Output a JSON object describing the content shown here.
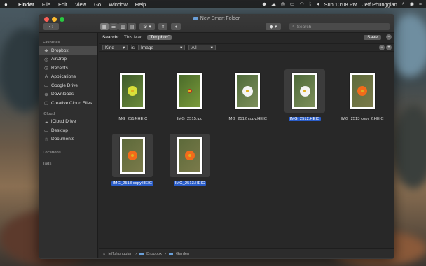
{
  "menubar": {
    "app": "Finder",
    "items": [
      "File",
      "Edit",
      "View",
      "Go",
      "Window",
      "Help"
    ],
    "clock": "Sun 10:08 PM",
    "user": "Jeff Phungglan"
  },
  "window": {
    "title": "New Smart Folder",
    "search_placeholder": "Search",
    "scope_label": "Search:",
    "scope_this_mac": "This Mac",
    "scope_active": "\"Dropbox\"",
    "save_label": "Save",
    "criteria": {
      "attribute": "Kind",
      "operator": "is",
      "value": "Image",
      "qualifier": "All"
    }
  },
  "sidebar": {
    "favorites_header": "Favorites",
    "favorites": [
      {
        "label": "Dropbox",
        "icon": "dropbox-icon"
      },
      {
        "label": "AirDrop",
        "icon": "airdrop-icon"
      },
      {
        "label": "Recents",
        "icon": "clock-icon"
      },
      {
        "label": "Applications",
        "icon": "applications-icon"
      },
      {
        "label": "Google Drive",
        "icon": "google-drive-icon"
      },
      {
        "label": "Downloads",
        "icon": "downloads-icon"
      },
      {
        "label": "Creative Cloud Files",
        "icon": "creative-cloud-icon"
      }
    ],
    "icloud_header": "iCloud",
    "icloud": [
      {
        "label": "iCloud Drive",
        "icon": "cloud-icon"
      },
      {
        "label": "Desktop",
        "icon": "desktop-icon"
      },
      {
        "label": "Documents",
        "icon": "document-icon"
      }
    ],
    "locations_header": "Locations",
    "tags_header": "Tags"
  },
  "files": [
    {
      "name": "IMG_2514.HEIC",
      "selected": false,
      "flower": "yellow"
    },
    {
      "name": "IMG_2515.jpg",
      "selected": false,
      "flower": "red-small"
    },
    {
      "name": "IMG_2512 copy.HEIC",
      "selected": false,
      "flower": "white"
    },
    {
      "name": "IMG_2512.HEIC",
      "selected": true,
      "flower": "white"
    },
    {
      "name": "IMG_2513 copy 2.HEIC",
      "selected": false,
      "flower": "orange"
    },
    {
      "name": "IMG_2513 copy.HEIC",
      "selected": true,
      "flower": "orange"
    },
    {
      "name": "IMG_2513.HEIC",
      "selected": true,
      "flower": "orange"
    }
  ],
  "pathbar": [
    "jeffphungglan",
    "Dropbox",
    "Garden"
  ],
  "colors": {
    "selection": "#2a5dc9",
    "folder": "#6a9fd8"
  }
}
